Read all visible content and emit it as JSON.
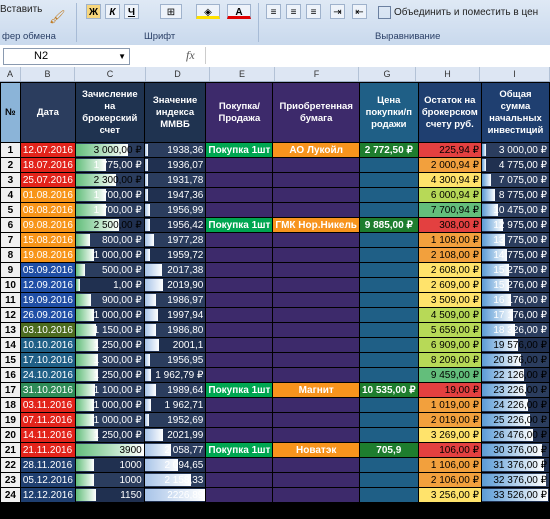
{
  "ribbon": {
    "paste_label": "Вставить",
    "clipboard_label": "фер обмена",
    "font_label": "Шрифт",
    "align_label": "Выравнивание",
    "merge_label": "Объединить и поместить в цен",
    "bold": "Ж",
    "italic": "К",
    "underline": "Ч"
  },
  "formula_bar": {
    "cell_ref": "N2",
    "fx": "fx"
  },
  "columns": [
    "A",
    "B",
    "C",
    "D",
    "E",
    "F",
    "G",
    "H",
    "I"
  ],
  "headers": {
    "num": "№",
    "date": "Дата",
    "deposit": "Зачисление на брокерский счет",
    "index": "Значение индекса ММВБ",
    "action": "Покупка/ Продажа",
    "security": "Приобретенная бумага",
    "price": "Цена покупки/п родажи",
    "balance": "Остаток на брокерском счету руб.",
    "total": "Общая сумма начальных инвестиций"
  },
  "rows": [
    {
      "n": "1",
      "date": "12.07.2016",
      "dep": "3 000,00 ₽",
      "idx": "1938,36",
      "act": "Покупка 1шт",
      "sec": "АО Лукойл",
      "price": "2 772,50 ₽",
      "bal": "225,94 ₽",
      "tot": "3 000,00 ₽"
    },
    {
      "n": "2",
      "date": "18.07.2016",
      "dep": "1 775,00 ₽",
      "idx": "1936,07",
      "act": "",
      "sec": "",
      "price": "",
      "bal": "2 000,94 ₽",
      "tot": "4 775,00 ₽"
    },
    {
      "n": "3",
      "date": "25.07.2016",
      "dep": "2 300,00 ₽",
      "idx": "1931,78",
      "act": "",
      "sec": "",
      "price": "",
      "bal": "4 300,94 ₽",
      "tot": "7 075,00 ₽"
    },
    {
      "n": "4",
      "date": "01.08.2016",
      "dep": "1 700,00 ₽",
      "idx": "1947,36",
      "act": "",
      "sec": "",
      "price": "",
      "bal": "6 000,94 ₽",
      "tot": "8 775,00 ₽"
    },
    {
      "n": "5",
      "date": "08.08.2016",
      "dep": "1 700,00 ₽",
      "idx": "1956,99",
      "act": "",
      "sec": "",
      "price": "",
      "bal": "7 700,94 ₽",
      "tot": "10 475,00 ₽"
    },
    {
      "n": "6",
      "date": "09.08.2016",
      "dep": "2 500,00 ₽",
      "idx": "1956,42",
      "act": "Покупка 1шт",
      "sec": "ГМК Нор.Никель",
      "price": "9 885,00 ₽",
      "bal": "308,00 ₽",
      "tot": "12 975,00 ₽"
    },
    {
      "n": "7",
      "date": "15.08.2016",
      "dep": "800,00 ₽",
      "idx": "1977,28",
      "act": "",
      "sec": "",
      "price": "",
      "bal": "1 108,00 ₽",
      "tot": "13 775,00 ₽"
    },
    {
      "n": "8",
      "date": "19.08.2016",
      "dep": "1 000,00 ₽",
      "idx": "1959,72",
      "act": "",
      "sec": "",
      "price": "",
      "bal": "2 108,00 ₽",
      "tot": "14 775,00 ₽"
    },
    {
      "n": "9",
      "date": "05.09.2016",
      "dep": "500,00 ₽",
      "idx": "2017,38",
      "act": "",
      "sec": "",
      "price": "",
      "bal": "2 608,00 ₽",
      "tot": "15 275,00 ₽"
    },
    {
      "n": "10",
      "date": "12.09.2016",
      "dep": "1,00 ₽",
      "idx": "2019,90",
      "act": "",
      "sec": "",
      "price": "",
      "bal": "2 609,00 ₽",
      "tot": "15 276,00 ₽"
    },
    {
      "n": "11",
      "date": "19.09.2016",
      "dep": "900,00 ₽",
      "idx": "1986,97",
      "act": "",
      "sec": "",
      "price": "",
      "bal": "3 509,00 ₽",
      "tot": "16 176,00 ₽"
    },
    {
      "n": "12",
      "date": "26.09.2016",
      "dep": "1 000,00 ₽",
      "idx": "1997,94",
      "act": "",
      "sec": "",
      "price": "",
      "bal": "4 509,00 ₽",
      "tot": "17 176,00 ₽"
    },
    {
      "n": "13",
      "date": "03.10.2016",
      "dep": "1 150,00 ₽",
      "idx": "1986,80",
      "act": "",
      "sec": "",
      "price": "",
      "bal": "5 659,00 ₽",
      "tot": "18 326,00 ₽"
    },
    {
      "n": "14",
      "date": "10.10.2016",
      "dep": "1 250,00 ₽",
      "idx": "2001,1",
      "act": "",
      "sec": "",
      "price": "",
      "bal": "6 909,00 ₽",
      "tot": "19 576,00 ₽"
    },
    {
      "n": "15",
      "date": "17.10.2016",
      "dep": "1 300,00 ₽",
      "idx": "1956,95",
      "act": "",
      "sec": "",
      "price": "",
      "bal": "8 209,00 ₽",
      "tot": "20 876,00 ₽"
    },
    {
      "n": "16",
      "date": "24.10.2016",
      "dep": "1 250,00 ₽",
      "idx": "1 962,79 ₽",
      "act": "",
      "sec": "",
      "price": "",
      "bal": "9 459,00 ₽",
      "tot": "22 126,00 ₽"
    },
    {
      "n": "17",
      "date": "31.10.2016",
      "dep": "1 100,00 ₽",
      "idx": "1989,64",
      "act": "Покупка 1шт",
      "sec": "Магнит",
      "price": "10 535,00 ₽",
      "bal": "19,00 ₽",
      "tot": "23 226,00 ₽"
    },
    {
      "n": "18",
      "date": "03.11.2016",
      "dep": "1 000,00 ₽",
      "idx": "1 962,71",
      "act": "",
      "sec": "",
      "price": "",
      "bal": "1 019,00 ₽",
      "tot": "24 226,00 ₽"
    },
    {
      "n": "19",
      "date": "07.11.2016",
      "dep": "1 000,00 ₽",
      "idx": "1952,69",
      "act": "",
      "sec": "",
      "price": "",
      "bal": "2 019,00 ₽",
      "tot": "25 226,00 ₽"
    },
    {
      "n": "20",
      "date": "14.11.2016",
      "dep": "1 250,00 ₽",
      "idx": "2021,99",
      "act": "",
      "sec": "",
      "price": "",
      "bal": "3 269,00 ₽",
      "tot": "26 476,00 ₽"
    },
    {
      "n": "21",
      "date": "21.11.2016",
      "dep": "3900",
      "idx": "2 058,77",
      "act": "Покупка 1шт",
      "sec": "Новатэк",
      "price": "705,9",
      "bal": "106,00 ₽",
      "tot": "30 376,00 ₽"
    },
    {
      "n": "22",
      "date": "28.11.2016",
      "dep": "1000",
      "idx": "2 094,65",
      "act": "",
      "sec": "",
      "price": "",
      "bal": "1 106,00 ₽",
      "tot": "31 376,00 ₽"
    },
    {
      "n": "23",
      "date": "05.12.2016",
      "dep": "1000",
      "idx": "2 158,33",
      "act": "",
      "sec": "",
      "price": "",
      "bal": "2 106,00 ₽",
      "tot": "32 376,00 ₽"
    },
    {
      "n": "24",
      "date": "12.12.2016",
      "dep": "1150",
      "idx": "2226,89",
      "act": "",
      "sec": "",
      "price": "",
      "bal": "3 256,00 ₽",
      "tot": "33 526,00 ₽"
    }
  ],
  "levels": {
    "dep": [
      0.77,
      0.45,
      0.59,
      0.44,
      0.44,
      0.64,
      0.21,
      0.26,
      0.13,
      0.0,
      0.23,
      0.26,
      0.29,
      0.32,
      0.33,
      0.32,
      0.28,
      0.26,
      0.26,
      0.32,
      1.0,
      0.26,
      0.26,
      0.29
    ],
    "idx": [
      0.03,
      0.02,
      0.0,
      0.05,
      0.09,
      0.08,
      0.15,
      0.09,
      0.29,
      0.3,
      0.19,
      0.22,
      0.19,
      0.24,
      0.09,
      0.1,
      0.19,
      0.1,
      0.07,
      0.3,
      0.43,
      0.55,
      0.77,
      1.0
    ],
    "tot": [
      0.0,
      0.05,
      0.13,
      0.19,
      0.24,
      0.32,
      0.35,
      0.38,
      0.4,
      0.4,
      0.43,
      0.46,
      0.5,
      0.54,
      0.58,
      0.62,
      0.66,
      0.69,
      0.72,
      0.76,
      0.89,
      0.92,
      0.95,
      0.99
    ]
  },
  "colors": {
    "date_red": "#e2231a",
    "date_orange": "#f79418",
    "date_blue": "#1f4ea6",
    "date_darkgreen": "#4c6b1f",
    "date_teal": "#1f5f86",
    "date_navy": "#1f3f70",
    "date_green": "#2e8b57",
    "dep_fill": "#63be7b",
    "idx_fill": "#a8c4e8",
    "tot_fill": "#5b9bd5",
    "bal_red": "#e34040",
    "bal_orange": "#f2a03d",
    "bal_yellow": "#ffe36b",
    "bal_lgreen": "#b7d957",
    "bal_green": "#63be7b",
    "action_green": "#00a651",
    "security_orange": "#f7941d",
    "price_green": "#1e7d2e"
  },
  "icons": [
    "paste-icon",
    "brush-icon",
    "bold-icon",
    "italic-icon",
    "underline-icon",
    "border-icon",
    "fill-color-icon",
    "font-color-icon",
    "align-left-icon",
    "align-center-icon",
    "align-right-icon",
    "indent-icon",
    "merge-icon",
    "fx-icon",
    "namebox-dropdown-icon"
  ]
}
